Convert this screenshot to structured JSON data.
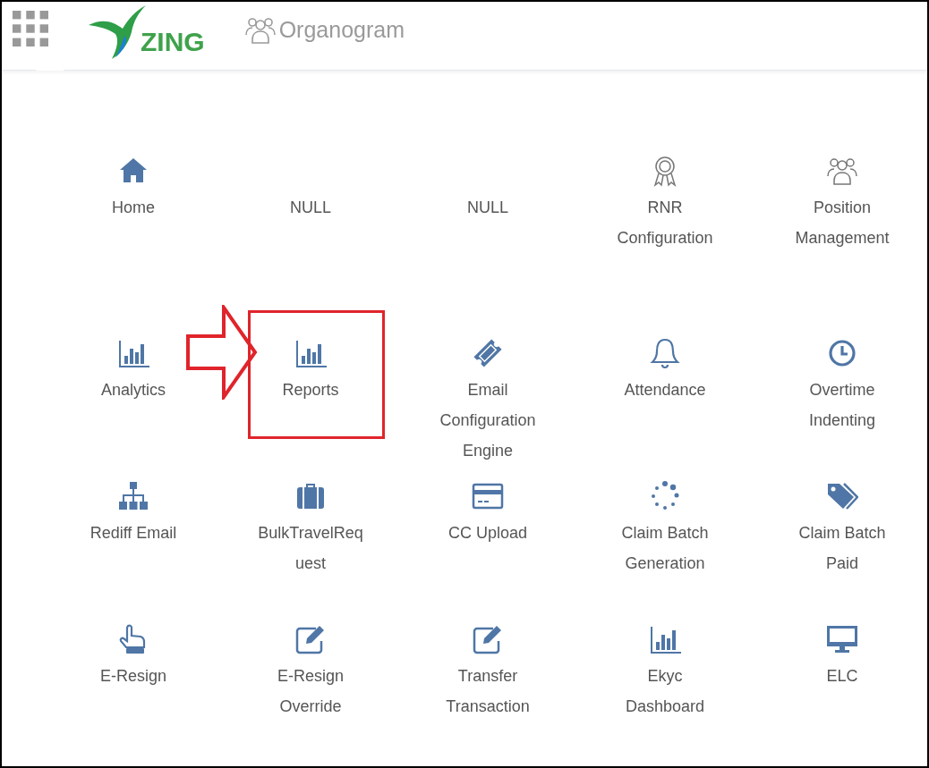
{
  "header": {
    "logo_text": "ZING",
    "nav_link": "Organogram"
  },
  "tiles": [
    {
      "label": "Home",
      "kind": "home",
      "highlighted": false
    },
    {
      "label": "NULL",
      "kind": "blank",
      "highlighted": false
    },
    {
      "label": "NULL",
      "kind": "blank",
      "highlighted": false
    },
    {
      "label": "RNR Configuration",
      "kind": "award",
      "highlighted": false
    },
    {
      "label": "Position Management",
      "kind": "users",
      "highlighted": false
    },
    {
      "label": "Analytics",
      "kind": "chart",
      "highlighted": false
    },
    {
      "label": "Reports",
      "kind": "chart",
      "highlighted": true
    },
    {
      "label": "Email Configuration Engine",
      "kind": "ticket",
      "highlighted": false
    },
    {
      "label": "Attendance",
      "kind": "bell",
      "highlighted": false
    },
    {
      "label": "Overtime Indenting",
      "kind": "clock",
      "highlighted": false
    },
    {
      "label": "Rediff Email",
      "kind": "sitemap",
      "highlighted": false
    },
    {
      "label": "BulkTravelRequest",
      "kind": "briefcase",
      "highlighted": false
    },
    {
      "label": "CC Upload",
      "kind": "card",
      "highlighted": false
    },
    {
      "label": "Claim Batch Generation",
      "kind": "spinner",
      "highlighted": false
    },
    {
      "label": "Claim Batch Paid",
      "kind": "tags",
      "highlighted": false
    },
    {
      "label": "E-Resign",
      "kind": "hand",
      "highlighted": false
    },
    {
      "label": "E-Resign Override",
      "kind": "edit",
      "highlighted": false
    },
    {
      "label": "Transfer Transaction",
      "kind": "edit",
      "highlighted": false
    },
    {
      "label": "Ekyc Dashboard",
      "kind": "chart",
      "highlighted": false
    },
    {
      "label": "ELC",
      "kind": "monitor",
      "highlighted": false
    }
  ]
}
